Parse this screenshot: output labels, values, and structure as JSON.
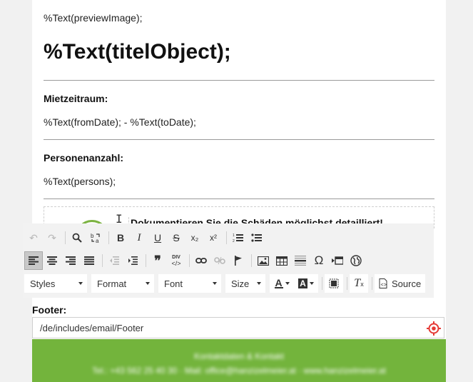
{
  "content": {
    "preview_image": "%Text(previewImage);",
    "title": "%Text(titelObject);",
    "period_label": "Mietzeitraum:",
    "period_value": "%Text(fromDate); - %Text(toDate);",
    "persons_label": "Personenanzahl:",
    "persons_value": "%Text(persons);",
    "doc_text": "Dokumentieren Sie die Schäden möglichst detailliert!"
  },
  "toolbar": {
    "row1": {
      "undo": "↶",
      "redo": "↷",
      "find": "🔍",
      "replace": "⇄",
      "bold": "B",
      "italic": "I",
      "underline": "U",
      "strike": "S",
      "subscript": "x₂",
      "superscript": "x²",
      "numbered_list": "≡",
      "bulleted_list": "☰"
    },
    "row2": {
      "quote": "❞",
      "div": "DIV",
      "special_char": "Ω"
    },
    "row3": {
      "styles": "Styles",
      "format": "Format",
      "font": "Font",
      "size": "Size",
      "text_color": "A",
      "bg_color": "A",
      "clear_format": "T",
      "source": "Source"
    }
  },
  "footer": {
    "label": "Footer:",
    "value": "/de/includes/email/Footer",
    "line1": "Kontaktdaten & Kontakt",
    "line2": "Tel.: +43 562 25 40 30 · Mail: office@hanzizelmeier.at · www.hanzizelmeier.at"
  },
  "colors": {
    "accent_green": "#73b43c",
    "target_red": "#e53935"
  }
}
